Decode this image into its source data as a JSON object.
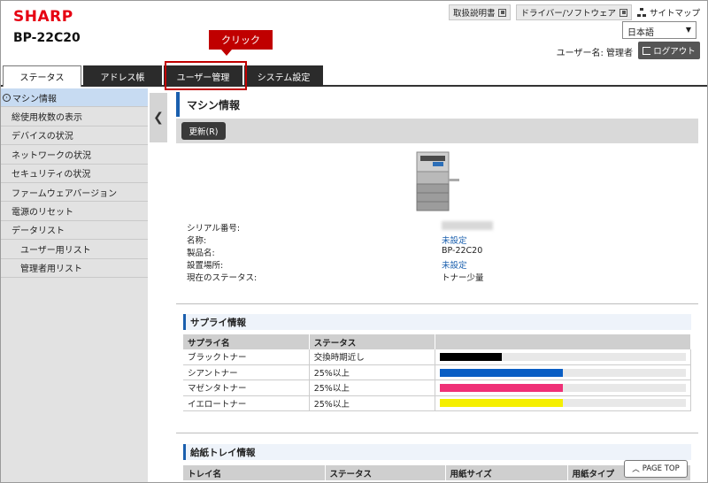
{
  "header": {
    "brand": "SHARP",
    "model": "BP-22C20",
    "links": [
      "取扱説明書",
      "ドライバー/ソフトウェア"
    ],
    "sitemap": "サイトマップ",
    "language": "日本語",
    "user_label": "ユーザー名: 管理者",
    "logout_label": "ログアウト"
  },
  "annotation": {
    "callout": "クリック"
  },
  "tabs": [
    {
      "label": "ステータス"
    },
    {
      "label": "アドレス帳"
    },
    {
      "label": "ユーザー管理"
    },
    {
      "label": "システム設定"
    }
  ],
  "sidebar": {
    "items": [
      {
        "label": "マシン情報"
      },
      {
        "label": "総使用枚数の表示"
      },
      {
        "label": "デバイスの状況"
      },
      {
        "label": "ネットワークの状況"
      },
      {
        "label": "セキュリティの状況"
      },
      {
        "label": "ファームウェアバージョン"
      },
      {
        "label": "電源のリセット"
      },
      {
        "label": "データリスト"
      },
      {
        "label": "ユーザー用リスト"
      },
      {
        "label": "管理者用リスト"
      }
    ]
  },
  "main": {
    "title": "マシン情報",
    "refresh_label": "更新(R)",
    "info": [
      {
        "label": "シリアル番号:",
        "value": ""
      },
      {
        "label": "名称:",
        "value": "未設定"
      },
      {
        "label": "製品名:",
        "value": "BP-22C20"
      },
      {
        "label": "設置場所:",
        "value": "未設定"
      },
      {
        "label": "現在のステータス:",
        "value": "トナー少量"
      }
    ],
    "supply": {
      "title": "サプライ情報",
      "headers": [
        "サプライ名",
        "ステータス"
      ],
      "rows": [
        {
          "name": "ブラックトナー",
          "status": "交換時期近し",
          "level": 0.25,
          "color": "#000000"
        },
        {
          "name": "シアントナー",
          "status": "25%以上",
          "level": 0.5,
          "color": "#0a5ec4"
        },
        {
          "name": "マゼンタトナー",
          "status": "25%以上",
          "level": 0.5,
          "color": "#ef3177"
        },
        {
          "name": "イエロートナー",
          "status": "25%以上",
          "level": 0.5,
          "color": "#f5ef00"
        }
      ]
    },
    "tray": {
      "title": "給紙トレイ情報",
      "headers": [
        "トレイ名",
        "ステータス",
        "用紙サイズ",
        "用紙タイプ"
      ]
    },
    "page_top": "PAGE TOP"
  }
}
